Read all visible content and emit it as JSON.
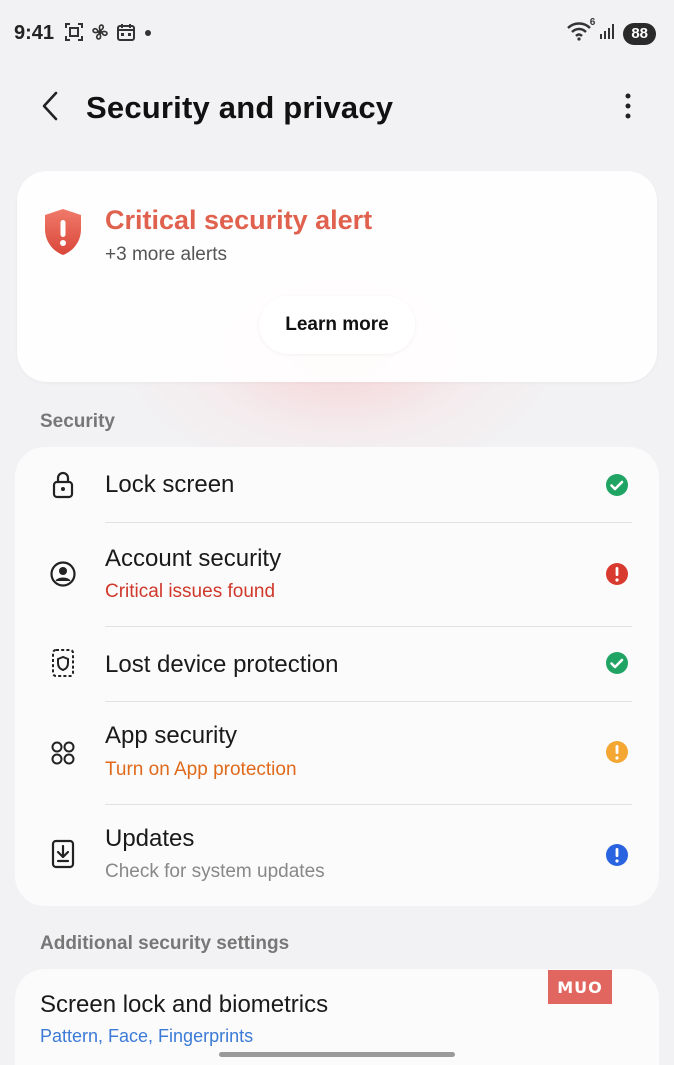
{
  "status_bar": {
    "time": "9:41",
    "wifi_sup": "6",
    "battery": "88",
    "left_icons": [
      "screenshot-icon",
      "fan-icon",
      "calendar-icon",
      "dot-icon"
    ],
    "right_icons": [
      "wifi-icon",
      "signal-icon"
    ]
  },
  "header": {
    "title": "Security and privacy",
    "back_icon": "chevron-left-icon",
    "more_icon": "more-vertical-icon"
  },
  "alert": {
    "title": "Critical security alert",
    "subtitle": "+3 more alerts",
    "button_label": "Learn more",
    "icon": "shield-alert-icon",
    "color": "#e0614e"
  },
  "security_section": {
    "label": "Security",
    "items": [
      {
        "title": "Lock screen",
        "subtitle": "",
        "icon": "lock-icon",
        "status": "ok"
      },
      {
        "title": "Account security",
        "subtitle": "Critical issues found",
        "subtitle_color": "#d0382b",
        "icon": "account-circle-icon",
        "status": "critical"
      },
      {
        "title": "Lost device protection",
        "subtitle": "",
        "icon": "device-shield-icon",
        "status": "ok"
      },
      {
        "title": "App security",
        "subtitle": "Turn on App protection",
        "subtitle_color": "#e06a1c",
        "icon": "apps-grid-icon",
        "status": "warning"
      },
      {
        "title": "Updates",
        "subtitle": "Check for system updates",
        "subtitle_color": "#888888",
        "icon": "download-box-icon",
        "status": "info"
      }
    ]
  },
  "status_colors": {
    "ok": "#1fa463",
    "critical": "#d93a2f",
    "warning": "#f4a733",
    "info": "#2a63e0"
  },
  "additional_section": {
    "label": "Additional security settings",
    "items": [
      {
        "title": "Screen lock and biometrics",
        "subtitle": "Pattern, Face, Fingerprints"
      }
    ]
  },
  "watermark": "MUO"
}
